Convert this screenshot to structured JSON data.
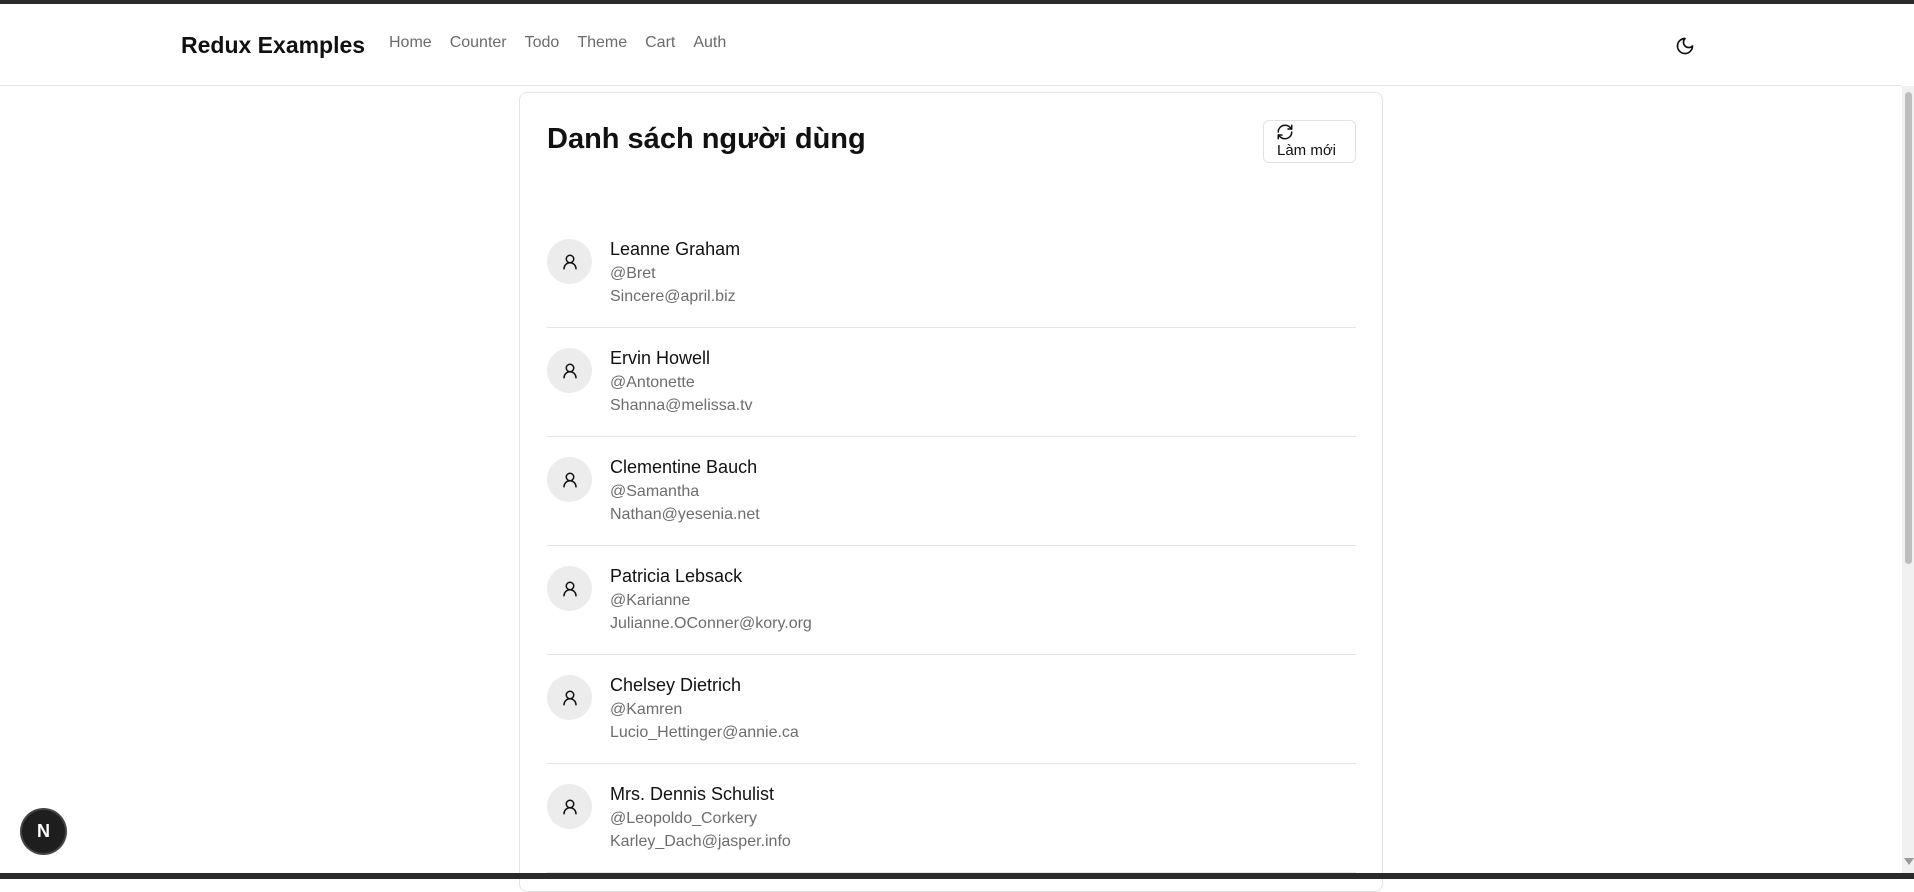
{
  "navbar": {
    "brand": "Redux Examples",
    "links": [
      "Home",
      "Counter",
      "Todo",
      "Theme",
      "Cart",
      "Auth"
    ],
    "theme_icon": "moon-icon"
  },
  "card": {
    "title": "Danh sách người dùng",
    "refresh_label": "Làm mới",
    "refresh_icon": "refresh-icon"
  },
  "users": [
    {
      "name": "Leanne Graham",
      "username": "@Bret",
      "email": "Sincere@april.biz"
    },
    {
      "name": "Ervin Howell",
      "username": "@Antonette",
      "email": "Shanna@melissa.tv"
    },
    {
      "name": "Clementine Bauch",
      "username": "@Samantha",
      "email": "Nathan@yesenia.net"
    },
    {
      "name": "Patricia Lebsack",
      "username": "@Karianne",
      "email": "Julianne.OConner@kory.org"
    },
    {
      "name": "Chelsey Dietrich",
      "username": "@Kamren",
      "email": "Lucio_Hettinger@annie.ca"
    },
    {
      "name": "Mrs. Dennis Schulist",
      "username": "@Leopoldo_Corkery",
      "email": "Karley_Dach@jasper.info"
    }
  ],
  "dev_badge": {
    "label": "N"
  }
}
